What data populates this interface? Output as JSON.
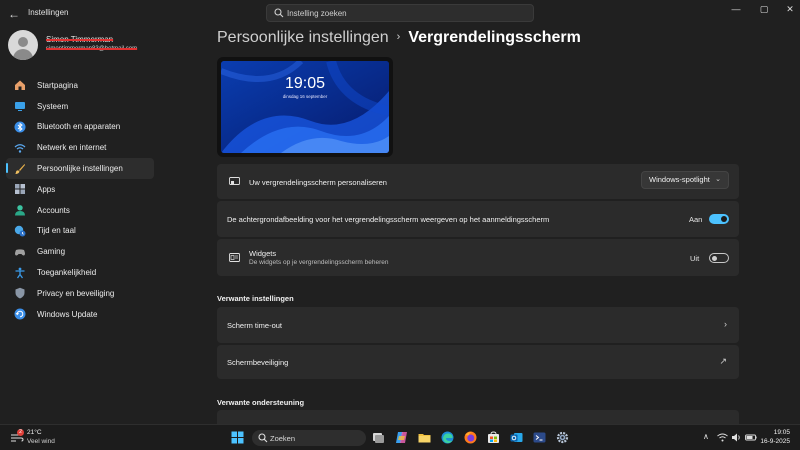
{
  "window": {
    "title": "Instellingen",
    "search_placeholder": "Instelling zoeken",
    "controls": {
      "minimize": "—",
      "maximize": "▢",
      "close": "✕"
    }
  },
  "user": {
    "name": "Simon Timmerman",
    "email": "simontimmerman83@hotmail.com"
  },
  "sidebar": {
    "items": [
      {
        "label": "Startpagina",
        "icon": "home-icon",
        "color": "#e8a06a"
      },
      {
        "label": "Systeem",
        "icon": "system-icon",
        "color": "#3aa0e8"
      },
      {
        "label": "Bluetooth en apparaten",
        "icon": "bluetooth-icon",
        "color": "#3a8ee8"
      },
      {
        "label": "Netwerk en internet",
        "icon": "wifi-icon",
        "color": "#5aa8f0"
      },
      {
        "label": "Persoonlijke instellingen",
        "icon": "brush-icon",
        "color": "#e8b04a",
        "active": true
      },
      {
        "label": "Apps",
        "icon": "apps-icon",
        "color": "#9aa6b8"
      },
      {
        "label": "Accounts",
        "icon": "accounts-icon",
        "color": "#3cc2a0"
      },
      {
        "label": "Tijd en taal",
        "icon": "globe-clock-icon",
        "color": "#4aa8e8"
      },
      {
        "label": "Gaming",
        "icon": "gaming-icon",
        "color": "#9a9a9a"
      },
      {
        "label": "Toegankelijkheid",
        "icon": "accessibility-icon",
        "color": "#3a9ae8"
      },
      {
        "label": "Privacy en beveiliging",
        "icon": "shield-icon",
        "color": "#8a96a6"
      },
      {
        "label": "Windows Update",
        "icon": "update-icon",
        "color": "#3a8ee8"
      }
    ]
  },
  "breadcrumb": {
    "parent": "Persoonlijke instellingen",
    "separator": "›",
    "current": "Vergrendelingsscherm"
  },
  "preview": {
    "time": "19:05",
    "date": "dinsdag 16 september"
  },
  "settings": {
    "personalize": {
      "label": "Uw vergrendelingsscherm personaliseren",
      "value": "Windows-spotlight",
      "chevron": "⌄"
    },
    "background": {
      "label": "De achtergrondafbeelding voor het vergrendelingsscherm weergeven op het aanmeldingsscherm",
      "state": "Aan",
      "on": true
    },
    "widgets": {
      "label": "Widgets",
      "description": "De widgets op je vergrendelingsscherm beheren",
      "state": "Uit",
      "on": false
    }
  },
  "related_settings": {
    "title": "Verwante instellingen",
    "items": [
      {
        "label": "Scherm time-out",
        "arrow": "›"
      },
      {
        "label": "Schermbeveiliging",
        "arrow": "↗"
      }
    ]
  },
  "related_support": {
    "title": "Verwante ondersteuning"
  },
  "taskbar": {
    "weather": {
      "temp": "21°C",
      "condition": "Veel wind",
      "badge": "2"
    },
    "search_placeholder": "Zoeken",
    "tray": {
      "chevron": "∧"
    },
    "clock": {
      "time": "19:05",
      "date": "16-9-2025"
    }
  },
  "colors": {
    "accent": "#4cc2ff",
    "background": "#202020",
    "card": "#2b2b2b"
  }
}
